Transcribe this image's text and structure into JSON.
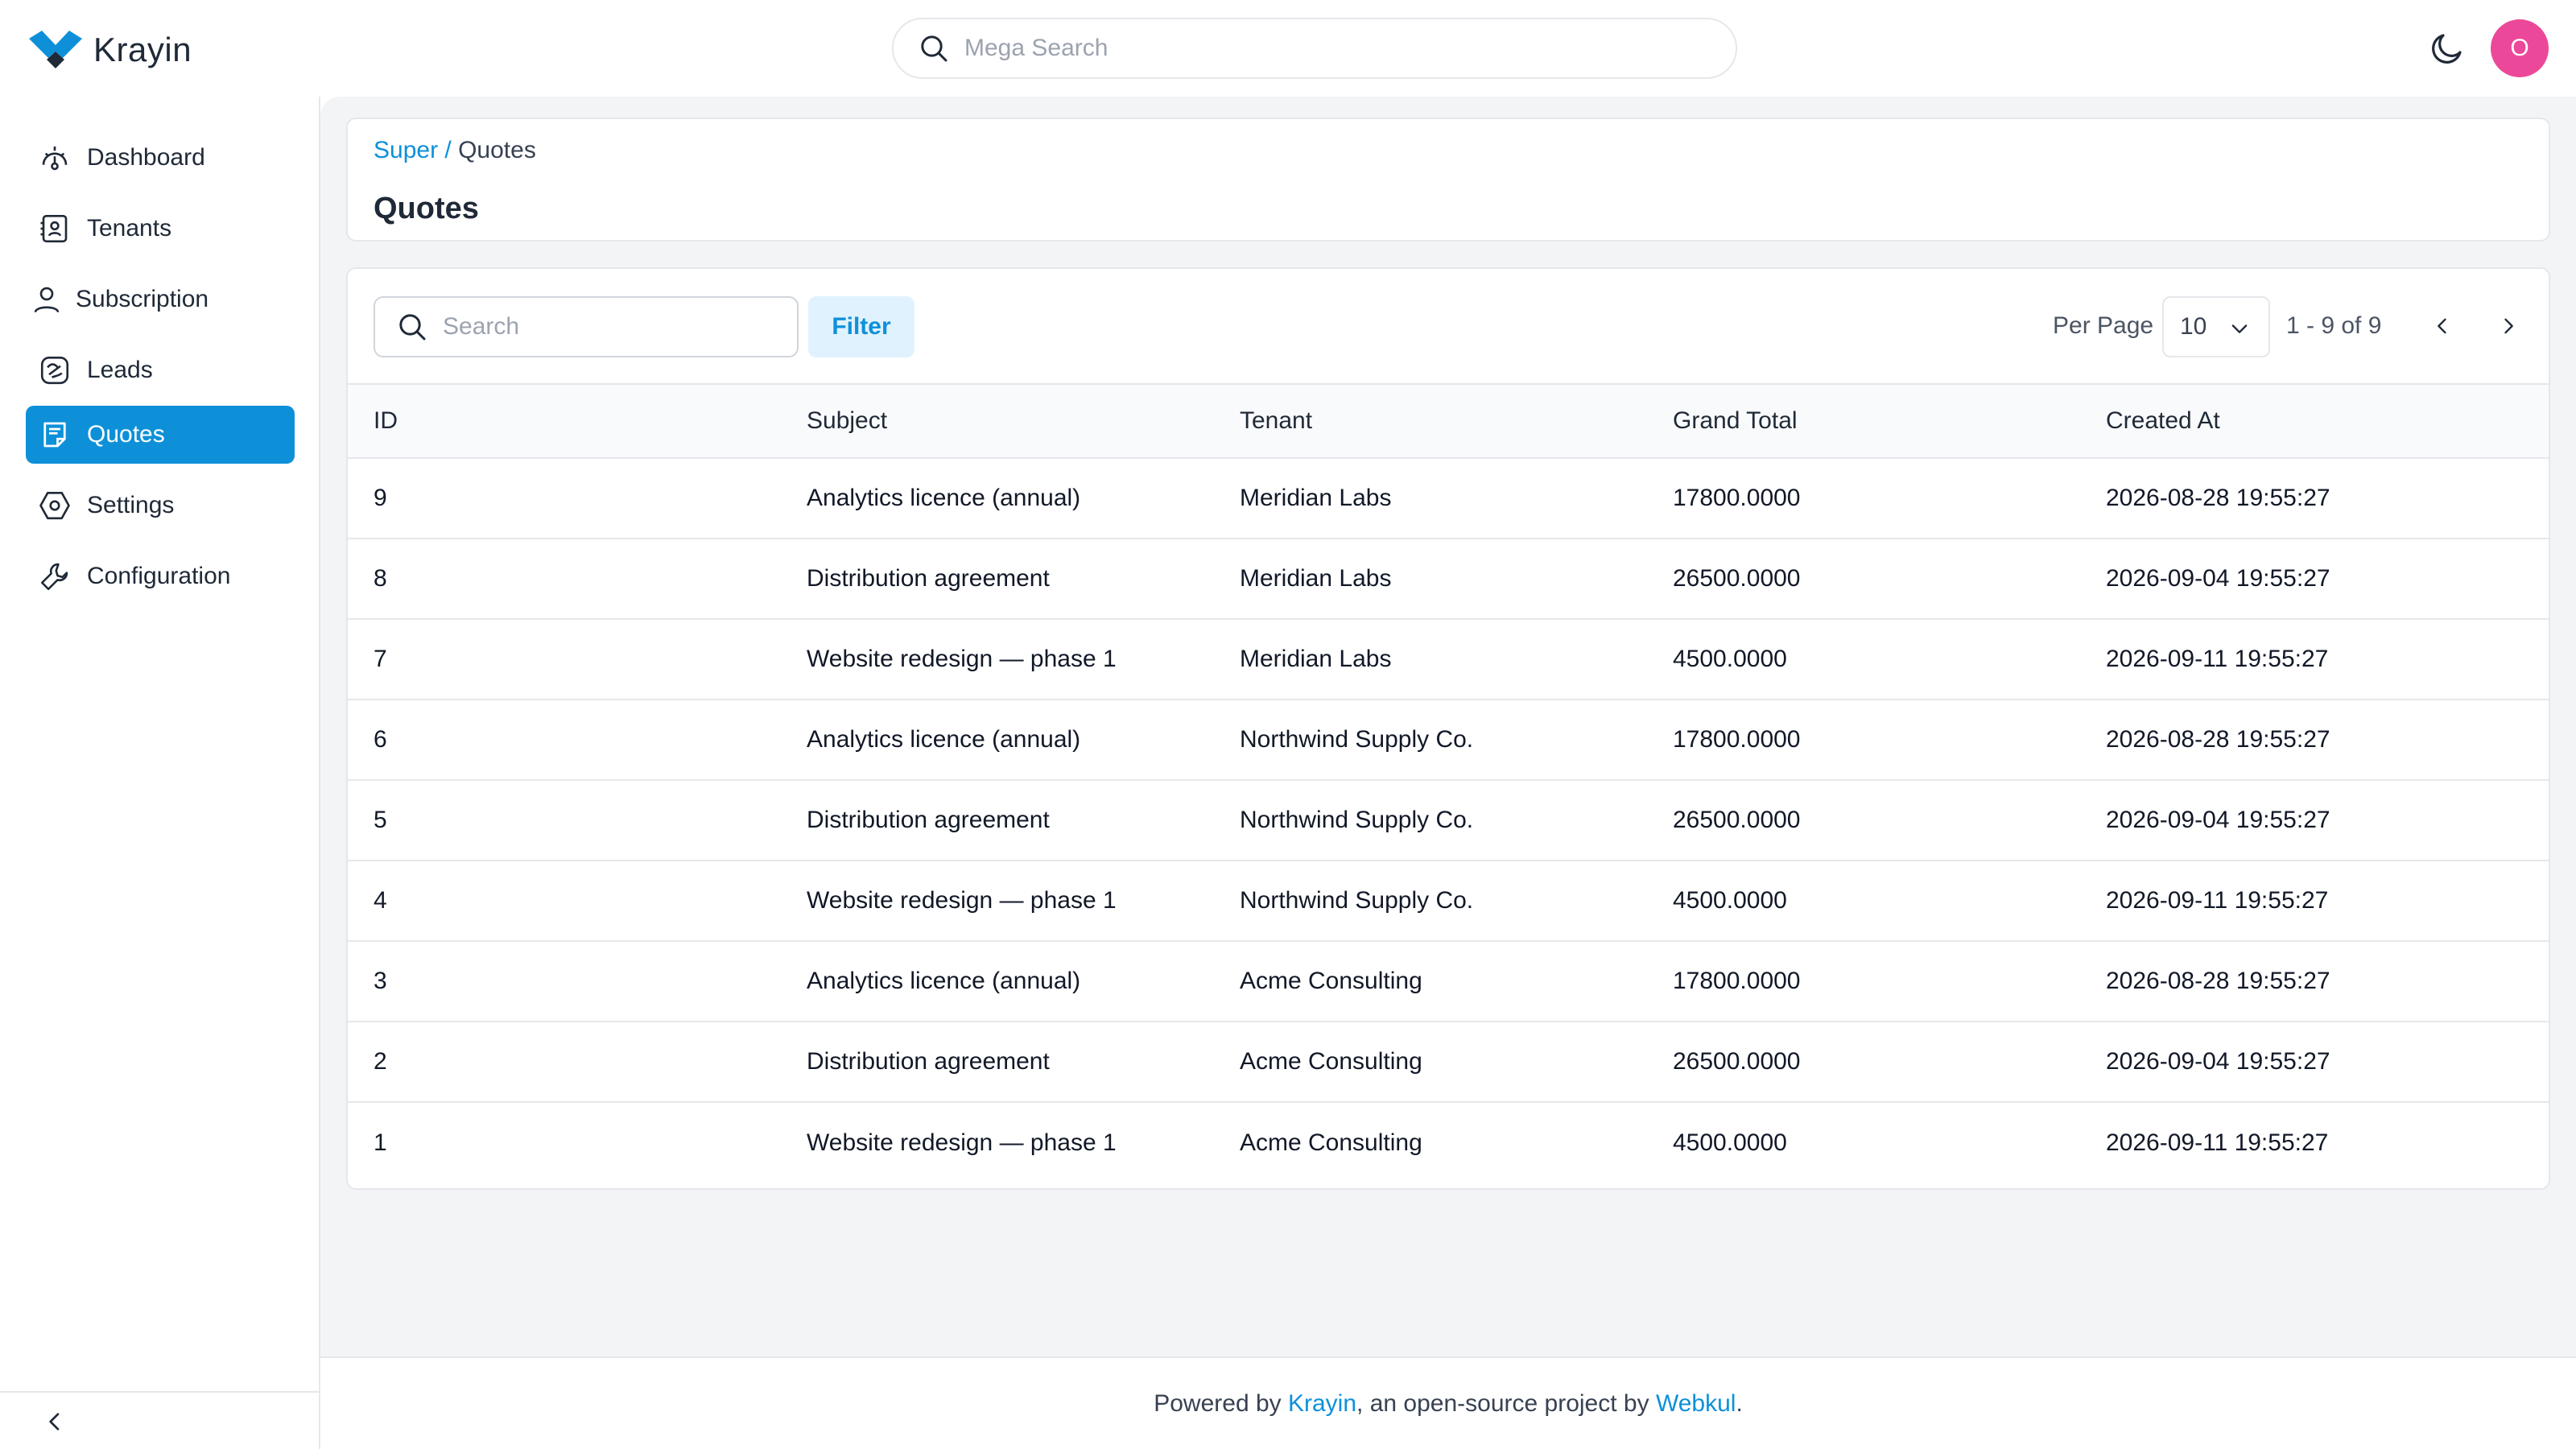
{
  "app": {
    "name": "Krayin"
  },
  "header": {
    "search_placeholder": "Mega Search",
    "avatar_initial": "O"
  },
  "sidebar": {
    "items": [
      {
        "label": "Dashboard",
        "icon": "dashboard-icon",
        "active": false
      },
      {
        "label": "Tenants",
        "icon": "tenants-icon",
        "active": false
      },
      {
        "label": "Subscription",
        "icon": "user-icon",
        "active": false
      },
      {
        "label": "Leads",
        "icon": "leads-icon",
        "active": false
      },
      {
        "label": "Quotes",
        "icon": "quotes-icon",
        "active": true
      },
      {
        "label": "Settings",
        "icon": "settings-icon",
        "active": false
      },
      {
        "label": "Configuration",
        "icon": "wrench-icon",
        "active": false
      }
    ]
  },
  "breadcrumb": {
    "parent": "Super",
    "separator": "/",
    "current": "Quotes"
  },
  "page": {
    "title": "Quotes"
  },
  "toolbar": {
    "search_placeholder": "Search",
    "filter_label": "Filter",
    "per_page_label": "Per Page",
    "per_page_value": "10",
    "page_info": "1 - 9 of 9"
  },
  "table": {
    "columns": [
      "ID",
      "Subject",
      "Tenant",
      "Grand Total",
      "Created At"
    ],
    "rows": [
      [
        "9",
        "Analytics licence (annual)",
        "Meridian Labs",
        "17800.0000",
        "2026-08-28 19:55:27"
      ],
      [
        "8",
        "Distribution agreement",
        "Meridian Labs",
        "26500.0000",
        "2026-09-04 19:55:27"
      ],
      [
        "7",
        "Website redesign — phase 1",
        "Meridian Labs",
        "4500.0000",
        "2026-09-11 19:55:27"
      ],
      [
        "6",
        "Analytics licence (annual)",
        "Northwind Supply Co.",
        "17800.0000",
        "2026-08-28 19:55:27"
      ],
      [
        "5",
        "Distribution agreement",
        "Northwind Supply Co.",
        "26500.0000",
        "2026-09-04 19:55:27"
      ],
      [
        "4",
        "Website redesign — phase 1",
        "Northwind Supply Co.",
        "4500.0000",
        "2026-09-11 19:55:27"
      ],
      [
        "3",
        "Analytics licence (annual)",
        "Acme Consulting",
        "17800.0000",
        "2026-08-28 19:55:27"
      ],
      [
        "2",
        "Distribution agreement",
        "Acme Consulting",
        "26500.0000",
        "2026-09-04 19:55:27"
      ],
      [
        "1",
        "Website redesign — phase 1",
        "Acme Consulting",
        "4500.0000",
        "2026-09-11 19:55:27"
      ]
    ]
  },
  "footer": {
    "prefix": "Powered by ",
    "link1": "Krayin",
    "middle": ", an open-source project by ",
    "link2": "Webkul",
    "suffix": "."
  },
  "colors": {
    "accent": "#0e90d9",
    "avatar": "#ec4899",
    "background": "#f3f4f6"
  }
}
